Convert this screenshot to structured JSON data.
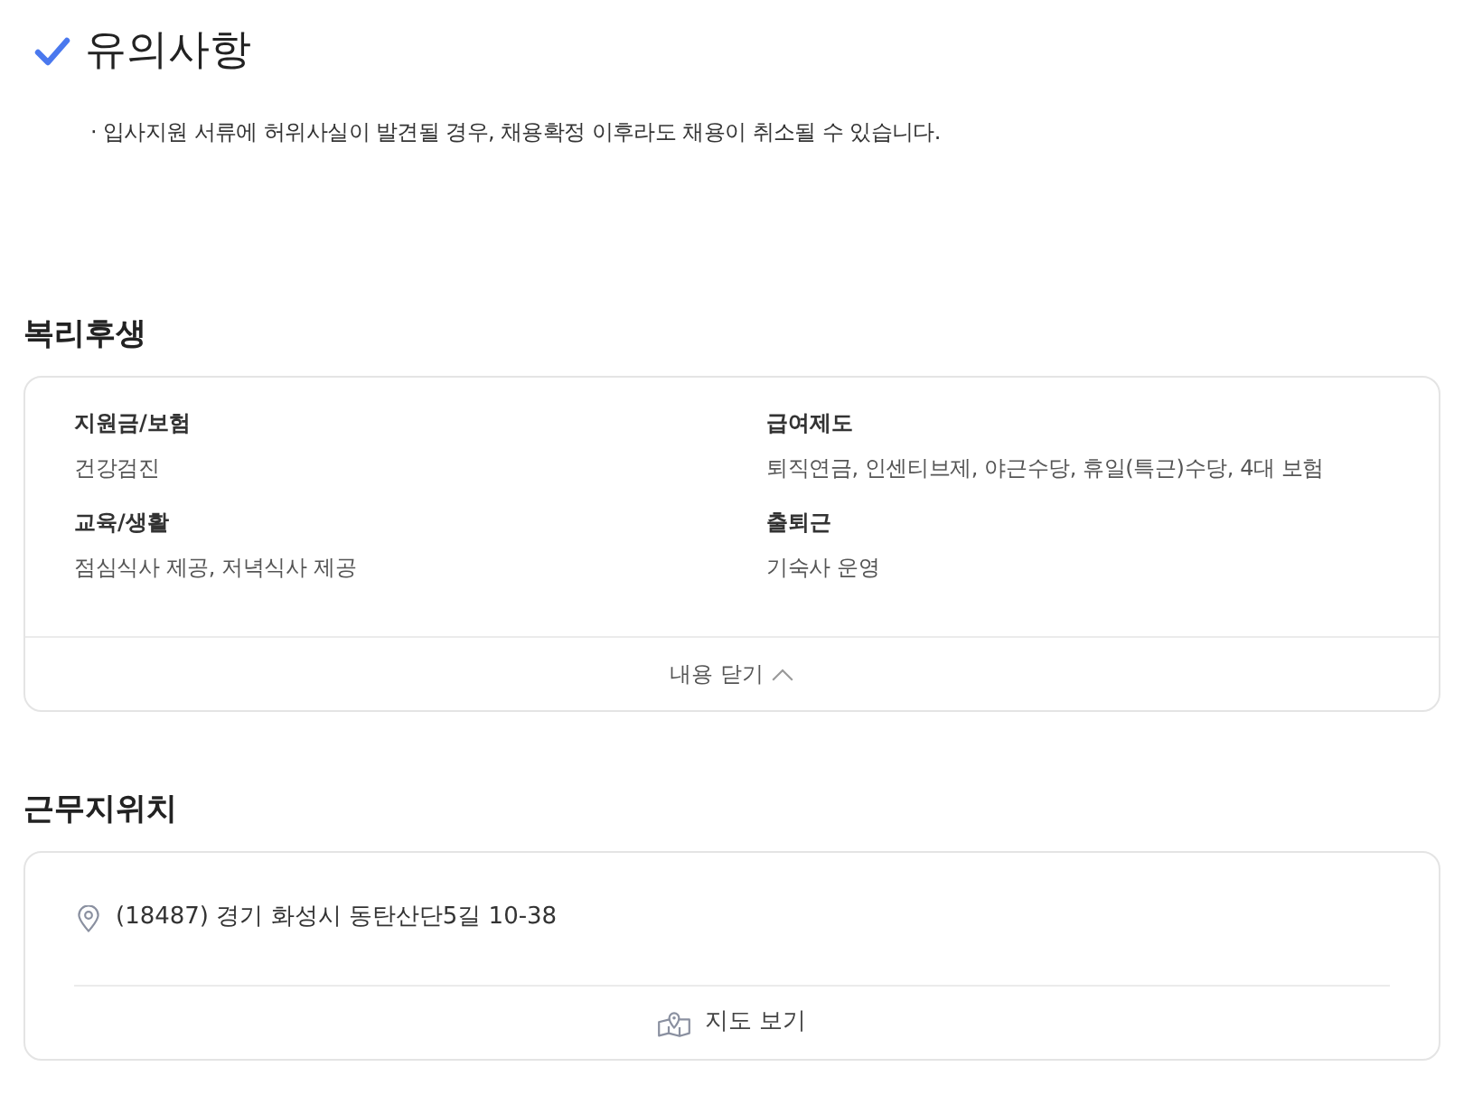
{
  "notice": {
    "title": "유의사항",
    "items": [
      "· 입사지원 서류에 허위사실이 발견될 경우, 채용확정 이후라도 채용이 취소될 수 있습니다."
    ]
  },
  "benefits": {
    "heading": "복리후생",
    "groups": [
      {
        "label": "지원금/보험",
        "value": "건강검진"
      },
      {
        "label": "급여제도",
        "value": "퇴직연금, 인센티브제, 야근수당, 휴일(특근)수당, 4대 보험"
      },
      {
        "label": "교육/생활",
        "value": "점심식사 제공, 저녁식사 제공"
      },
      {
        "label": "출퇴근",
        "value": "기숙사 운영"
      }
    ],
    "toggle": {
      "label": "내용 닫기",
      "expanded": true
    }
  },
  "location": {
    "heading": "근무지위치",
    "address": "(18487) 경기 화성시 동탄산단5길 10-38",
    "map_button": "지도 보기"
  }
}
